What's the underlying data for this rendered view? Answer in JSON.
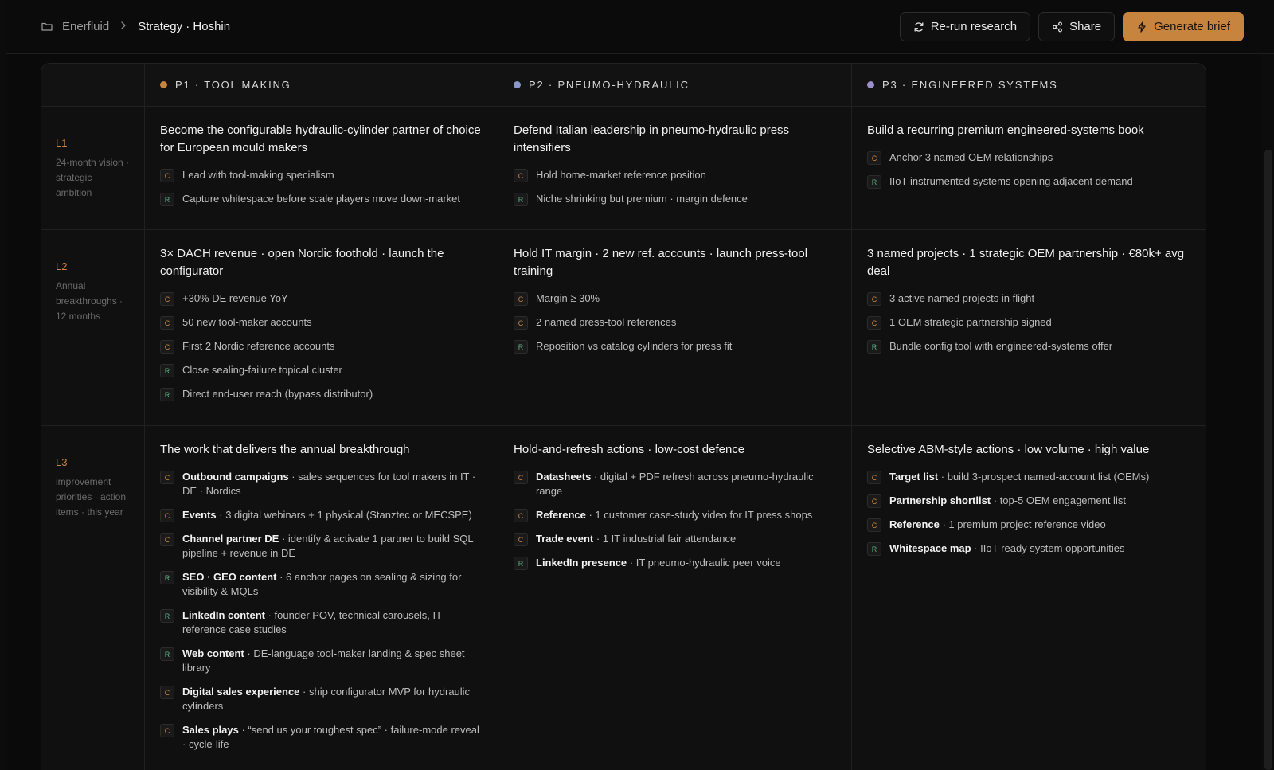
{
  "breadcrumb": {
    "workspace": "Enerfluid",
    "page": "Strategy · Hoshin"
  },
  "toolbar": {
    "rerun_label": "Re-run research",
    "share_label": "Share",
    "generate_label": "Generate brief"
  },
  "colors": {
    "accent": "#c7843f",
    "p2": "#8a97c9",
    "p3": "#9a8fc9",
    "reinforce": "#5fae86"
  },
  "columns": [
    {
      "label": "P1 · TOOL MAKING",
      "color": "#c7843f"
    },
    {
      "label": "P2 · PNEUMO-HYDRAULIC",
      "color": "#8a97c9"
    },
    {
      "label": "P3 · ENGINEERED SYSTEMS",
      "color": "#9a8fc9"
    }
  ],
  "levels": [
    {
      "tag": "L1",
      "desc": "24-month vision · strategic ambition",
      "cells": [
        {
          "title": "Become the configurable hydraulic-cylinder partner of choice for European mould makers",
          "items": [
            {
              "type": "C",
              "bold": "",
              "text": "Lead with tool-making specialism"
            },
            {
              "type": "R",
              "bold": "",
              "text": "Capture whitespace before scale players move down-market"
            }
          ]
        },
        {
          "title": "Defend Italian leadership in pneumo-hydraulic press intensifiers",
          "items": [
            {
              "type": "C",
              "bold": "",
              "text": "Hold home-market reference position"
            },
            {
              "type": "R",
              "bold": "",
              "text": "Niche shrinking but premium · margin defence"
            }
          ]
        },
        {
          "title": "Build a recurring premium engineered-systems book",
          "items": [
            {
              "type": "C",
              "bold": "",
              "text": "Anchor 3 named OEM relationships"
            },
            {
              "type": "R",
              "bold": "",
              "text": "IIoT-instrumented systems opening adjacent demand"
            }
          ]
        }
      ]
    },
    {
      "tag": "L2",
      "desc": "Annual breakthroughs · 12 months",
      "cells": [
        {
          "title": "3× DACH revenue · open Nordic foothold · launch the configurator",
          "items": [
            {
              "type": "C",
              "bold": "",
              "text": "+30% DE revenue YoY"
            },
            {
              "type": "C",
              "bold": "",
              "text": "50 new tool-maker accounts"
            },
            {
              "type": "C",
              "bold": "",
              "text": "First 2 Nordic reference accounts"
            },
            {
              "type": "R",
              "bold": "",
              "text": "Close sealing-failure topical cluster"
            },
            {
              "type": "R",
              "bold": "",
              "text": "Direct end-user reach (bypass distributor)"
            }
          ]
        },
        {
          "title": "Hold IT margin · 2 new ref. accounts · launch press-tool training",
          "items": [
            {
              "type": "C",
              "bold": "",
              "text": "Margin ≥ 30%"
            },
            {
              "type": "C",
              "bold": "",
              "text": "2 named press-tool references"
            },
            {
              "type": "R",
              "bold": "",
              "text": "Reposition vs catalog cylinders for press fit"
            }
          ]
        },
        {
          "title": "3 named projects · 1 strategic OEM partnership · €80k+ avg deal",
          "items": [
            {
              "type": "C",
              "bold": "",
              "text": "3 active named projects in flight"
            },
            {
              "type": "C",
              "bold": "",
              "text": "1 OEM strategic partnership signed"
            },
            {
              "type": "R",
              "bold": "",
              "text": "Bundle config tool with engineered-systems offer"
            }
          ]
        }
      ]
    },
    {
      "tag": "L3",
      "desc": "improvement priorities · action items · this year",
      "cells": [
        {
          "title": "The work that delivers the annual breakthrough",
          "items": [
            {
              "type": "C",
              "bold": "Outbound campaigns",
              "text": " · sales sequences for tool makers in IT · DE · Nordics"
            },
            {
              "type": "C",
              "bold": "Events",
              "text": " · 3 digital webinars + 1 physical (Stanztec or MECSPE)"
            },
            {
              "type": "C",
              "bold": "Channel partner DE",
              "text": " · identify & activate 1 partner to build SQL pipeline + revenue in DE"
            },
            {
              "type": "R",
              "bold": "SEO · GEO content",
              "text": " · 6 anchor pages on sealing & sizing for visibility & MQLs"
            },
            {
              "type": "R",
              "bold": "LinkedIn content",
              "text": " · founder POV, technical carousels, IT-reference case studies"
            },
            {
              "type": "R",
              "bold": "Web content",
              "text": " · DE-language tool-maker landing & spec sheet library"
            },
            {
              "type": "C",
              "bold": "Digital sales experience",
              "text": " · ship configurator MVP for hydraulic cylinders"
            },
            {
              "type": "C",
              "bold": "Sales plays",
              "text": " · “send us your toughest spec” · failure-mode reveal · cycle-life"
            }
          ]
        },
        {
          "title": "Hold-and-refresh actions · low-cost defence",
          "items": [
            {
              "type": "C",
              "bold": "Datasheets",
              "text": " · digital + PDF refresh across pneumo-hydraulic range"
            },
            {
              "type": "C",
              "bold": "Reference",
              "text": " · 1 customer case-study video for IT press shops"
            },
            {
              "type": "C",
              "bold": "Trade event",
              "text": " · 1 IT industrial fair attendance"
            },
            {
              "type": "R",
              "bold": "LinkedIn presence",
              "text": " · IT pneumo-hydraulic peer voice"
            }
          ]
        },
        {
          "title": "Selective ABM-style actions · low volume · high value",
          "items": [
            {
              "type": "C",
              "bold": "Target list",
              "text": " · build 3-prospect named-account list (OEMs)"
            },
            {
              "type": "C",
              "bold": "Partnership shortlist",
              "text": " · top-5 OEM engagement list"
            },
            {
              "type": "C",
              "bold": "Reference",
              "text": " · 1 premium project reference video"
            },
            {
              "type": "R",
              "bold": "Whitespace map",
              "text": " · IIoT-ready system opportunities"
            }
          ]
        }
      ]
    }
  ]
}
